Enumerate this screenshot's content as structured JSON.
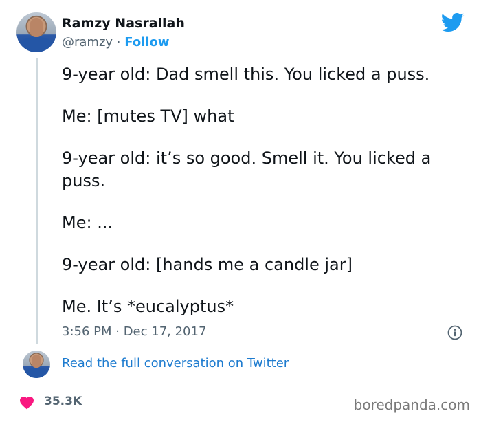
{
  "author": {
    "name": "Ramzy Nasrallah",
    "handle": "@ramzy",
    "separator": " · ",
    "follow_label": "Follow"
  },
  "tweet": {
    "paragraphs": [
      "9-year old: Dad smell this. You licked a puss.",
      "Me: [mutes TV] what",
      "9-year old: it’s so good. Smell it. You licked a puss.",
      "Me: ...",
      "9-year old: [hands me a candle jar]",
      "Me. It’s *eucalyptus*"
    ],
    "timestamp": "3:56 PM · Dec 17, 2017"
  },
  "conversation_link": "Read the full conversation on Twitter",
  "engagement": {
    "likes": "35.3K"
  },
  "watermark": "boredpanda.com",
  "colors": {
    "twitter_blue": "#1d9bf0",
    "heart": "#f91880",
    "text_primary": "#0f1419",
    "text_secondary": "#536471"
  },
  "icons": {
    "brand": "twitter-bird-icon",
    "info": "info-icon",
    "like": "heart-icon"
  }
}
